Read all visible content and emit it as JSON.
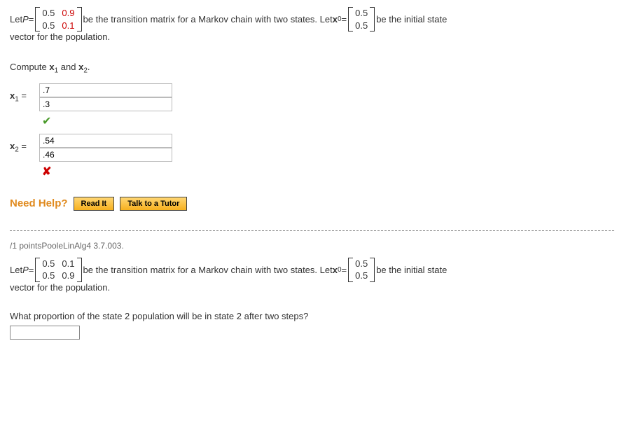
{
  "q1": {
    "let": "Let ",
    "P": "P",
    "eq": " = ",
    "m": [
      [
        "0.5",
        "0.9"
      ],
      [
        "0.5",
        "0.1"
      ]
    ],
    "mid": " be the transition matrix for a Markov chain with two states. Let ",
    "x": "x",
    "x0sub": "0",
    "v0": [
      "0.5",
      "0.5"
    ],
    "tail": " be the initial state",
    "line2": "vector for the population.",
    "compute": "Compute ",
    "x1lab": "x",
    "x1sub": "1",
    "and": " and ",
    "x2lab": "x",
    "x2sub": "2",
    "dot": ".",
    "x1eq": " = ",
    "x2eq": " = ",
    "x1vals": [
      ".7",
      ".3"
    ],
    "x2vals": [
      ".54",
      ".46"
    ]
  },
  "help": {
    "label": "Need Help?",
    "read": "Read It",
    "tutor": "Talk to a Tutor"
  },
  "q2": {
    "points": "/1 pointsPooleLinAlg4 3.7.003.",
    "let": "Let ",
    "P": "P",
    "eq": " = ",
    "m": [
      [
        "0.5",
        "0.1"
      ],
      [
        "0.5",
        "0.9"
      ]
    ],
    "mid": " be the transition matrix for a Markov chain with two states. Let ",
    "x": "x",
    "x0sub": "0",
    "v0": [
      "0.5",
      "0.5"
    ],
    "tail": " be the initial state",
    "line2": "vector for the population.",
    "ask": "What proportion of the state 2 population will be in state 2 after two steps?"
  }
}
